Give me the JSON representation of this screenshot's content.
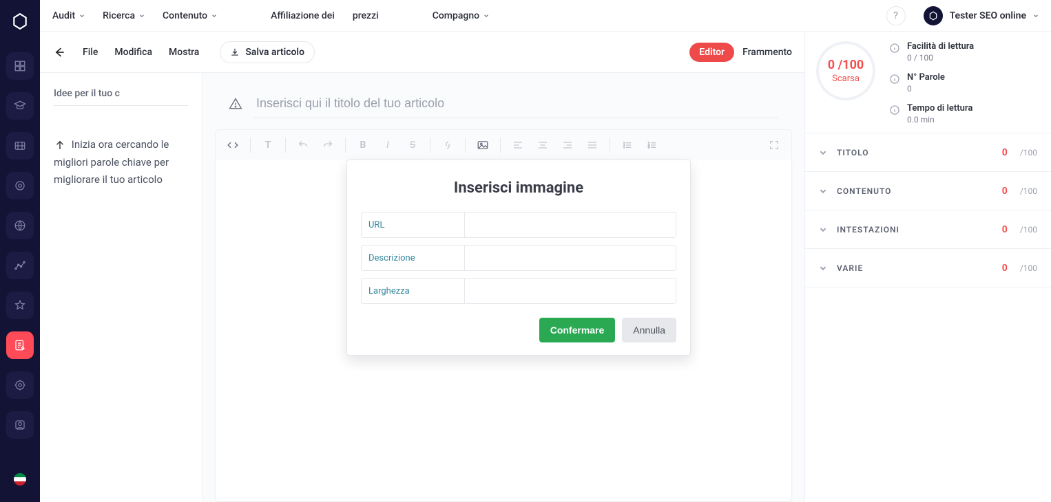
{
  "topnav": {
    "items": [
      {
        "label": "Audit",
        "dropdown": true
      },
      {
        "label": "Ricerca",
        "dropdown": true
      },
      {
        "label": "Contenuto",
        "dropdown": true
      },
      {
        "label": "Affiliazione dei",
        "dropdown": false
      },
      {
        "label": "prezzi",
        "dropdown": false
      },
      {
        "label": "Compagno",
        "dropdown": true
      }
    ],
    "help_tooltip": "?",
    "user": {
      "name": "Tester SEO online"
    }
  },
  "subbar": {
    "menu": {
      "file": "File",
      "edit": "Modifica",
      "show": "Mostra"
    },
    "save_label": "Salva articolo",
    "editor": "Editor",
    "fragment": "Frammento"
  },
  "leftpanel": {
    "ideas_tab": "Idee per il tuo c",
    "hint": "Inizia ora cercando le migliori parole chiave per migliorare il tuo articolo"
  },
  "editor": {
    "title_placeholder": "Inserisci qui il titolo del tuo articolo"
  },
  "modal": {
    "title": "Inserisci immagine",
    "url_label": "URL",
    "desc_label": "Descrizione",
    "width_label": "Larghezza",
    "confirm": "Confermare",
    "cancel": "Annulla"
  },
  "metrics": {
    "score": "0 /100",
    "quality": "Scarsa",
    "readability": {
      "label": "Facilità di lettura",
      "value": "0 / 100"
    },
    "words": {
      "label": "N° Parole",
      "value": "0"
    },
    "read_time": {
      "label": "Tempo di lettura",
      "value": "0.0 min"
    },
    "sections": [
      {
        "label": "TITOLO",
        "score": "0",
        "den": "/100"
      },
      {
        "label": "CONTENUTO",
        "score": "0",
        "den": "/100"
      },
      {
        "label": "INTESTAZIONI",
        "score": "0",
        "den": "/100"
      },
      {
        "label": "VARIE",
        "score": "0",
        "den": "/100"
      }
    ]
  }
}
